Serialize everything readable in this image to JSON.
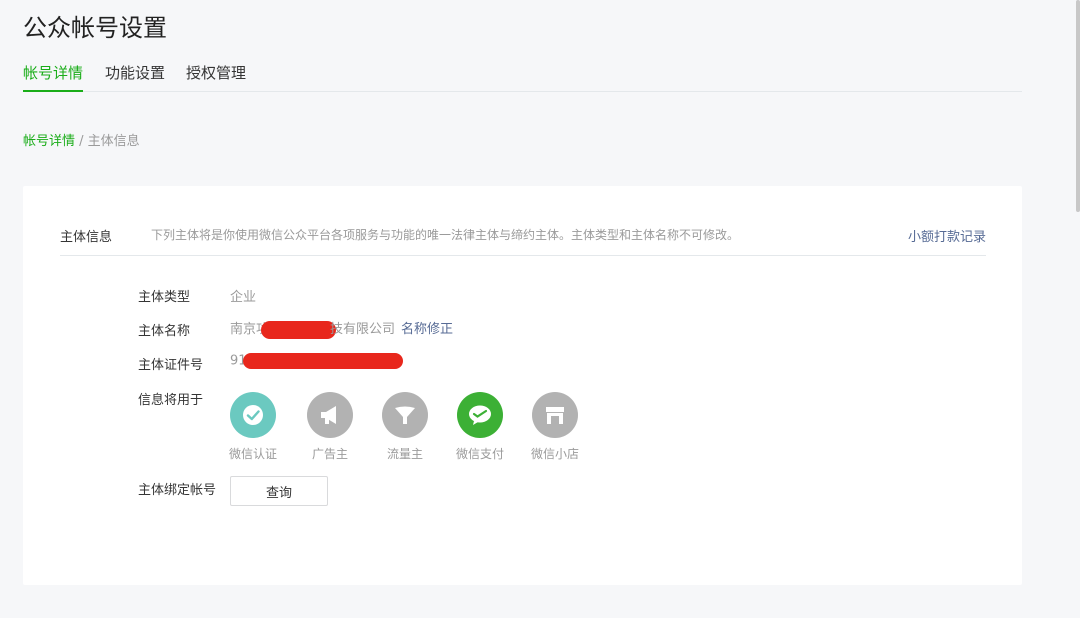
{
  "page": {
    "title": "公众帐号设置"
  },
  "tabs": [
    {
      "label": "帐号详情",
      "active": true
    },
    {
      "label": "功能设置",
      "active": false
    },
    {
      "label": "授权管理",
      "active": false
    }
  ],
  "breadcrumb": {
    "link": "帐号详情",
    "separator": " / ",
    "current": "主体信息"
  },
  "section": {
    "title": "主体信息",
    "description": "下列主体将是你使用微信公众平台各项服务与功能的唯一法律主体与缔约主体。主体类型和主体名称不可修改。",
    "link": "小额打款记录"
  },
  "fields": {
    "type_label": "主体类型",
    "type_value": "企业",
    "name_label": "主体名称",
    "name_prefix": "南京功",
    "name_suffix": "技有限公司",
    "name_link": "名称修正",
    "cert_label": "主体证件号",
    "cert_prefix": "91",
    "usage_label": "信息将用于",
    "bind_label": "主体绑定帐号"
  },
  "usages": [
    {
      "label": "微信认证",
      "icon": "verified-check-icon",
      "color": "#6bc9c0"
    },
    {
      "label": "广告主",
      "icon": "megaphone-icon",
      "color": "#b2b2b2"
    },
    {
      "label": "流量主",
      "icon": "funnel-icon",
      "color": "#b2b2b2"
    },
    {
      "label": "微信支付",
      "icon": "wechat-pay-icon",
      "color": "#3cb035"
    },
    {
      "label": "微信小店",
      "icon": "store-icon",
      "color": "#b2b2b2"
    }
  ],
  "query_button": {
    "label": "查询"
  }
}
